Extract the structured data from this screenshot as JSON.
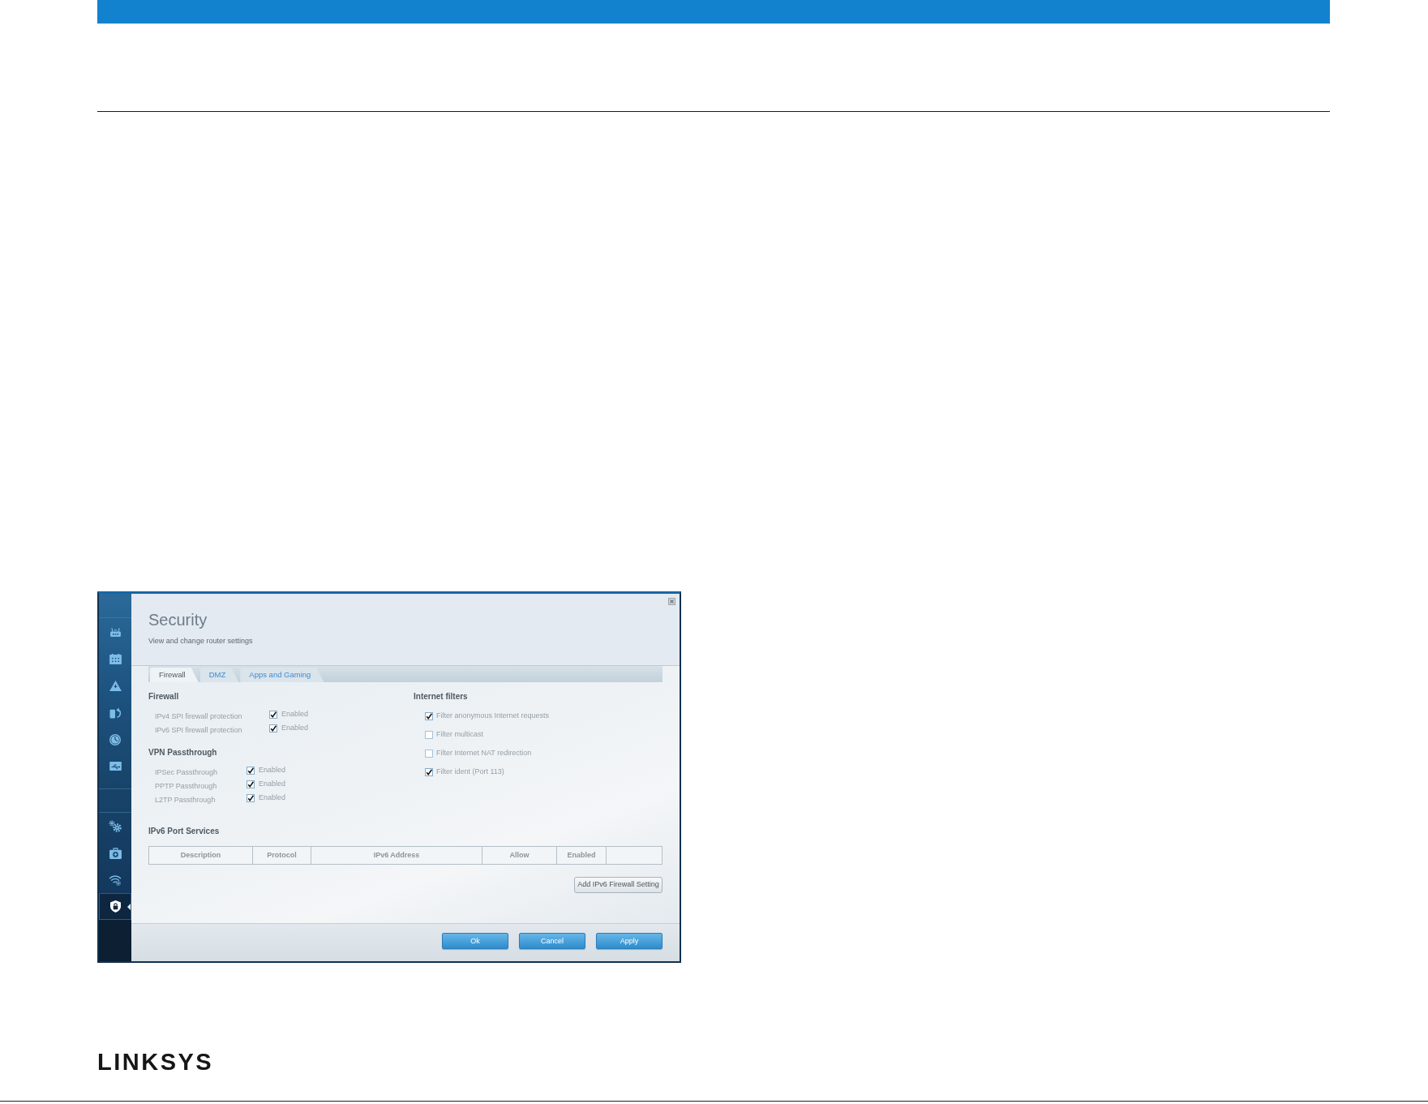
{
  "app": {
    "sidebar": {
      "groups": [
        {
          "items": [
            {
              "selected": false
            },
            {
              "selected": false
            },
            {
              "selected": false
            },
            {
              "selected": false
            },
            {
              "selected": false
            },
            {
              "selected": false
            }
          ]
        },
        {
          "items": [
            {
              "selected": false
            },
            {
              "selected": false
            },
            {
              "selected": false
            },
            {
              "selected": true
            }
          ]
        }
      ]
    },
    "title": "Security",
    "subtitle": "View and change router settings",
    "tabs": [
      {
        "label": "Firewall",
        "selected": true
      },
      {
        "label": "DMZ",
        "selected": false
      },
      {
        "label": "Apps and Gaming",
        "selected": false
      }
    ],
    "firewall": {
      "heading": "Firewall",
      "rows": [
        {
          "label": "IPv4 SPI firewall protection",
          "checked": true,
          "option": "Enabled"
        },
        {
          "label": "IPv6 SPI firewall protection",
          "checked": true,
          "option": "Enabled"
        }
      ]
    },
    "vpn_passthrough": {
      "heading": "VPN Passthrough",
      "rows": [
        {
          "label": "IPSec Passthrough",
          "checked": true,
          "option": "Enabled"
        },
        {
          "label": "PPTP Passthrough",
          "checked": true,
          "option": "Enabled"
        },
        {
          "label": "L2TP Passthrough",
          "checked": true,
          "option": "Enabled"
        }
      ]
    },
    "internet_filters": {
      "heading": "Internet filters",
      "items": [
        {
          "label": "Filter anonymous Internet requests",
          "checked": true
        },
        {
          "label": "Filter multicast",
          "checked": false
        },
        {
          "label": "Filter Internet NAT redirection",
          "checked": false
        },
        {
          "label": "Filter ident (Port 113)",
          "checked": true
        }
      ]
    },
    "ipv6_port_services": {
      "heading": "IPv6 Port Services",
      "table": {
        "columns": [
          "Description",
          "Protocol",
          "IPv6 Address",
          "Allow",
          "Enabled"
        ]
      },
      "add_button": "Add IPv6 Firewall Setting"
    },
    "buttons": [
      "Ok",
      "Cancel",
      "Apply"
    ]
  },
  "footer": {
    "brand": "LINKSYS"
  }
}
